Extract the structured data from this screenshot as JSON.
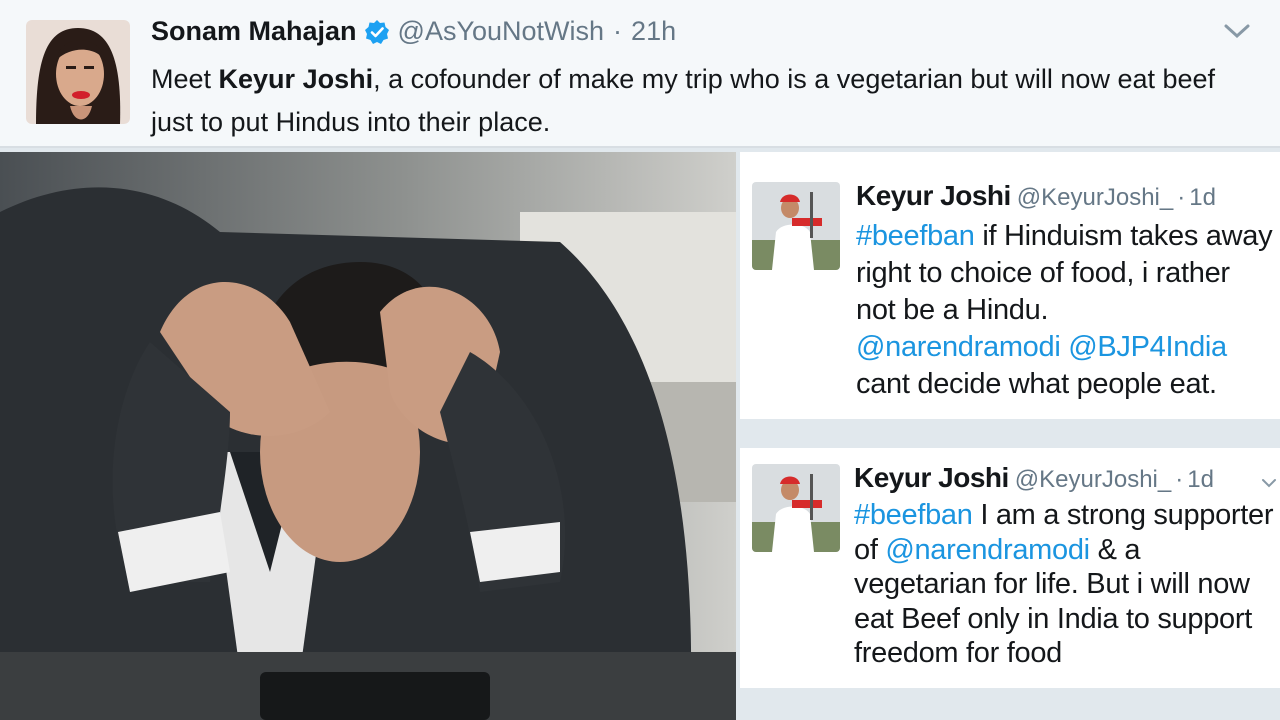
{
  "top_tweet": {
    "name": "Sonam Mahajan",
    "handle": "@AsYouNotWish",
    "separator": "·",
    "time": "21h",
    "text_before": "Meet ",
    "text_bold": "Keyur Joshi",
    "text_after": ", a cofounder of make my trip who is a vegetarian but will now eat beef just to put Hindus into their place."
  },
  "tweet_1": {
    "name": "Keyur Joshi",
    "handle": "@KeyurJoshi_",
    "separator": "·",
    "time": "1d",
    "hashtag": "#beefban",
    "text_a": " if Hinduism takes away right to choice of food, i rather not be a Hindu.",
    "mention_1": "@narendramodi",
    "mention_2": "@BJP4India",
    "text_b": "cant decide what people eat."
  },
  "tweet_2": {
    "name": "Keyur Joshi",
    "handle": "@KeyurJoshi_",
    "separator": "·",
    "time": "1d",
    "hashtag": "#beefban",
    "text_a": " I am a strong supporter of ",
    "mention_1": "@narendramodi",
    "text_b": " & a vegetarian for life. But i will now eat Beef only in India to support freedom for food"
  },
  "colors": {
    "link": "#1b95e0",
    "verified": "#1da1f2",
    "muted": "#657786",
    "text": "#14171a"
  },
  "icons": {
    "verified": "verified-badge-icon",
    "chevron": "chevron-down-icon"
  }
}
